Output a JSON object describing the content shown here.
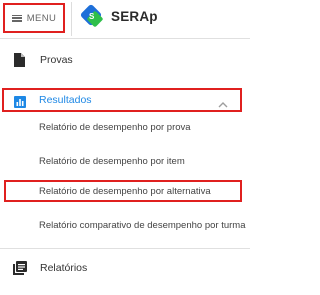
{
  "header": {
    "menu_label": "MENU",
    "brand": "SERAp"
  },
  "nav": {
    "provas": {
      "label": "Provas",
      "icon": "document-icon"
    },
    "resultados": {
      "label": "Resultados",
      "icon": "bar-chart-icon",
      "expanded": true,
      "accent_color": "#1e88e5",
      "children": [
        {
          "label": "Relatório de desempenho por prova"
        },
        {
          "label": "Relatório de desempenho por item"
        },
        {
          "label": "Relatório de desempenho por alternativa"
        },
        {
          "label": "Relatório comparativo de desempenho por turma"
        }
      ]
    },
    "relatorios": {
      "label": "Relatórios",
      "icon": "library-books-icon"
    }
  },
  "colors": {
    "highlight_border": "#e0201f",
    "logo_blue": "#1e6fd9",
    "logo_green": "#2fbf4a"
  }
}
